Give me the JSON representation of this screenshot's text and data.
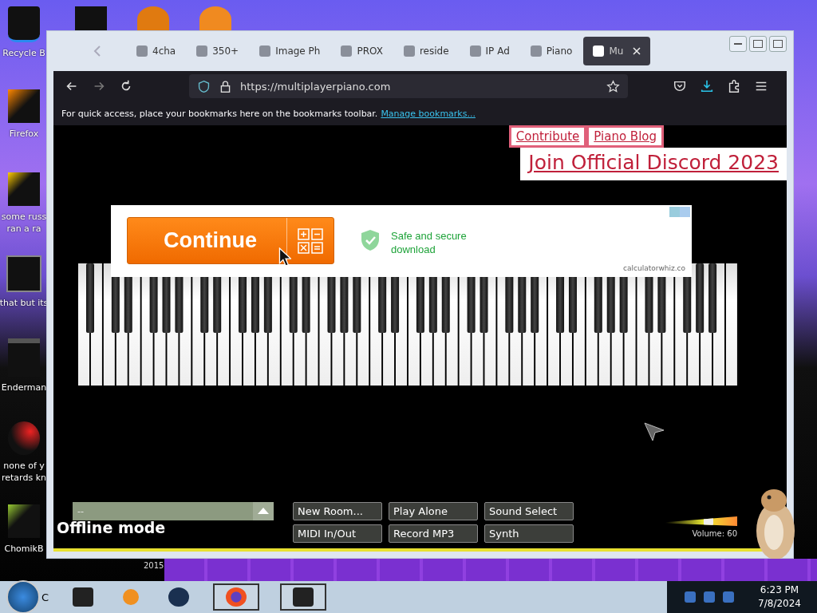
{
  "desktop": {
    "icons": [
      {
        "lines": [
          "Recycle B"
        ],
        "kind": "bin"
      },
      {
        "lines": [
          "Firefox"
        ],
        "kind": "fox"
      },
      {
        "lines": [
          "some russ",
          "ran a ra"
        ],
        "kind": "doc"
      },
      {
        "lines": [
          "that but its"
        ],
        "kind": "stack"
      },
      {
        "lines": [
          "Enderman"
        ],
        "kind": "screen"
      },
      {
        "lines": [
          "none of y",
          "retards kn"
        ],
        "kind": "round"
      },
      {
        "lines": [
          "ChomikB"
        ],
        "kind": "pet"
      }
    ],
    "wallpaper_caption": "2015"
  },
  "browser": {
    "tabs": [
      {
        "label": "4cha",
        "selected": false
      },
      {
        "label": "350+",
        "selected": false
      },
      {
        "label": "Image Ph",
        "selected": false
      },
      {
        "label": "PROX",
        "selected": false
      },
      {
        "label": "reside",
        "selected": false
      },
      {
        "label": "IP Ad",
        "selected": false
      },
      {
        "label": "Piano",
        "selected": false
      },
      {
        "label": "Mu",
        "selected": true
      }
    ],
    "url": "https://multiplayerpiano.com",
    "bookmarks_hint": {
      "text": "For quick access, place your bookmarks here on the bookmarks toolbar.",
      "link": "Manage bookmarks..."
    }
  },
  "page": {
    "links": [
      "Contribute",
      "Piano Blog"
    ],
    "discord": "Join Official Discord 2023",
    "ad": {
      "button": "Continue",
      "message": "Safe and secure download",
      "domain": "calculatorwhiz.co"
    },
    "room_select": "--",
    "status": "Offline mode",
    "buttons": [
      "New Room...",
      "Play Alone",
      "Sound Select",
      "MIDI In/Out",
      "Record MP3",
      "Synth"
    ],
    "volume": {
      "label": "Volume: 60",
      "level": 0.6
    }
  },
  "taskbar": {
    "start_letter": "C",
    "apps": [
      {
        "kind": "printer",
        "open": false
      },
      {
        "kind": "player",
        "open": false
      },
      {
        "kind": "globe",
        "open": false
      },
      {
        "kind": "fox",
        "open": true
      },
      {
        "kind": "screen",
        "open": true
      }
    ],
    "time": "6:23 PM",
    "date": "7/8/2024"
  }
}
